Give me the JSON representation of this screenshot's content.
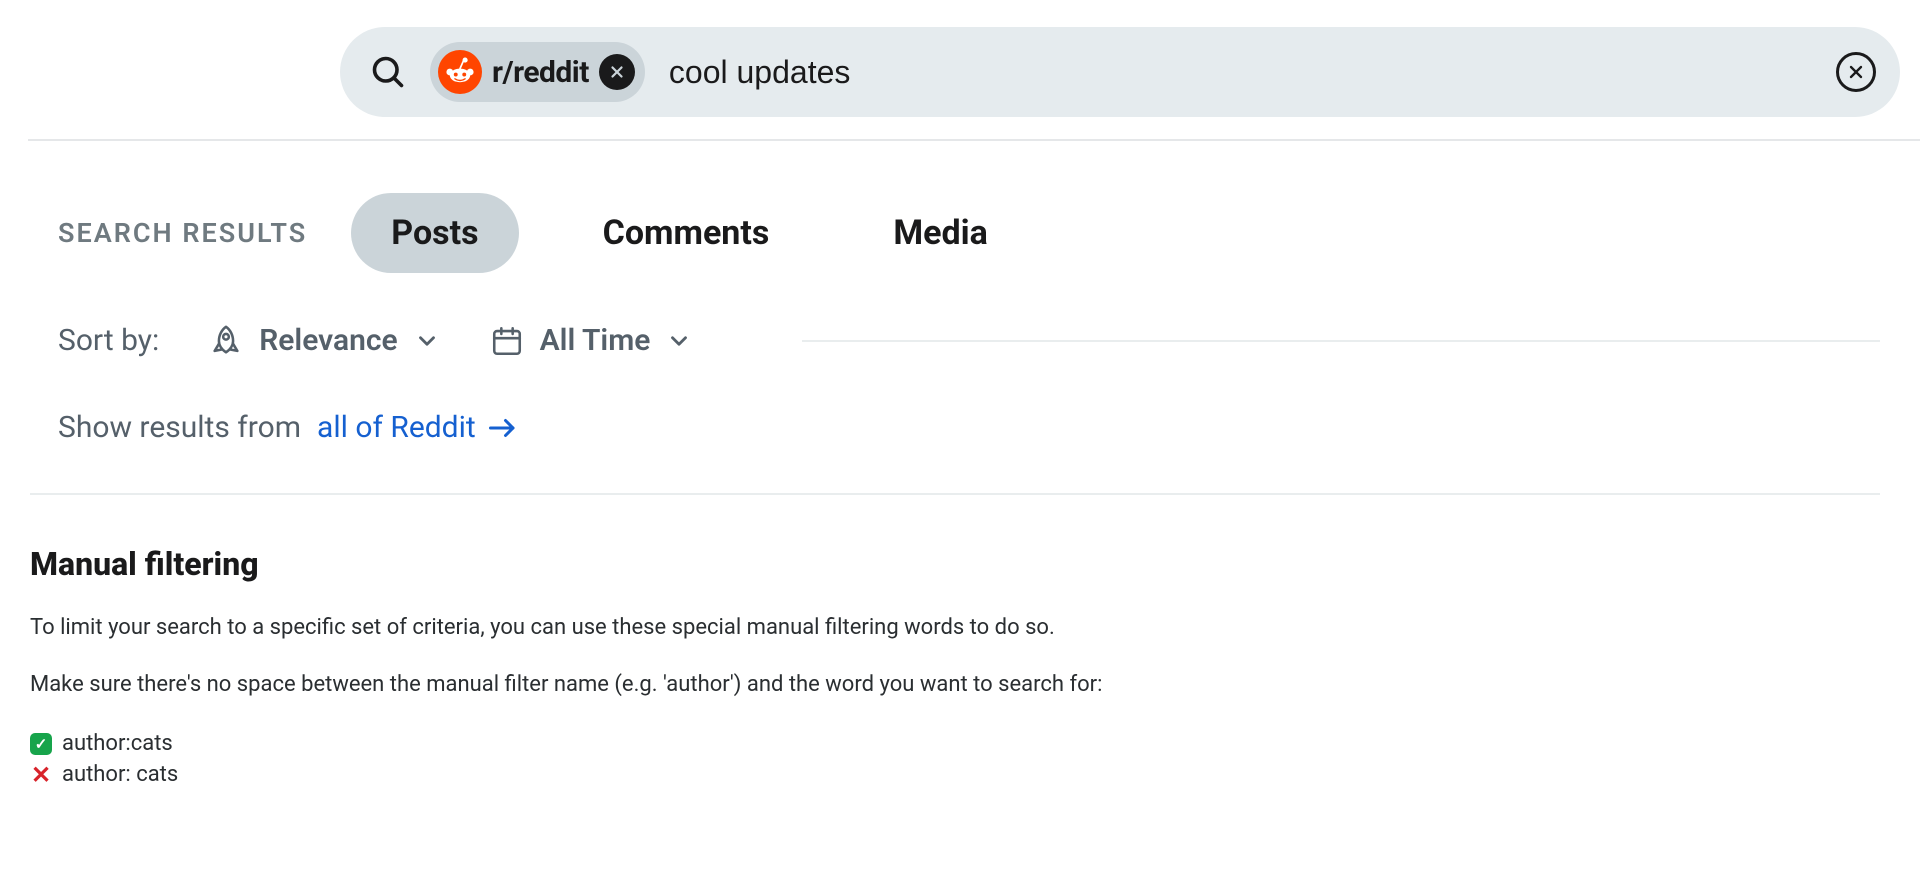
{
  "search": {
    "scope_label": "r/reddit",
    "query": "cool updates"
  },
  "tabs": {
    "caption": "SEARCH RESULTS",
    "items": [
      "Posts",
      "Comments",
      "Media"
    ],
    "active_index": 0
  },
  "sort": {
    "label": "Sort by:",
    "value": "Relevance",
    "time_value": "All Time"
  },
  "all_reddit": {
    "prefix": "Show results from",
    "link_text": "all of Reddit"
  },
  "article": {
    "heading": "Manual filtering",
    "p1": "To limit your search to a specific set of criteria, you can use these special manual filtering words to do so.",
    "p2": "Make sure there's no space between the manual filter name (e.g. 'author') and the word you want to search for:",
    "example_good": "author:cats",
    "example_bad": "author: cats"
  }
}
